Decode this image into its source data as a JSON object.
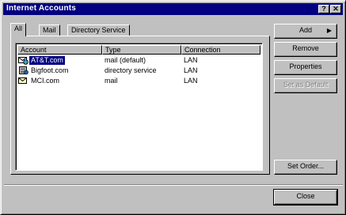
{
  "window": {
    "title": "Internet Accounts",
    "help_button": "?",
    "close_button": "✕"
  },
  "tabs": [
    {
      "label": "All",
      "active": true
    },
    {
      "label": "Mail",
      "active": false
    },
    {
      "label": "Directory Service",
      "active": false
    }
  ],
  "list": {
    "columns": [
      "Account",
      "Type",
      "Connection"
    ],
    "rows": [
      {
        "account": "AT&T.com",
        "type": "mail (default)",
        "connection": "LAN",
        "icon": "mail-account-icon",
        "selected": true
      },
      {
        "account": "Bigfoot.com",
        "type": "directory service",
        "connection": "LAN",
        "icon": "directory-service-icon",
        "selected": false
      },
      {
        "account": "MCI.com",
        "type": "mail",
        "connection": "LAN",
        "icon": "mail-account-icon",
        "selected": false
      }
    ]
  },
  "buttons": {
    "add": "Add",
    "remove": "Remove",
    "properties": "Properties",
    "set_as_default": "Set as Default",
    "set_order": "Set Order...",
    "close": "Close"
  },
  "colors": {
    "titlebar": "#000080",
    "selection": "#000080",
    "face": "#c0c0c0"
  }
}
